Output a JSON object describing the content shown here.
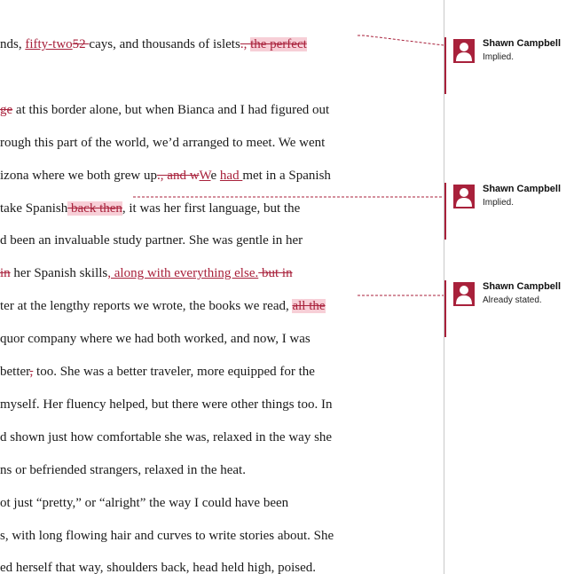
{
  "document": {
    "lines": [
      [
        {
          "t": "nds, ",
          "s": ""
        },
        {
          "t": "fifty-two",
          "s": "ins"
        },
        {
          "t": "52 ",
          "s": "del"
        },
        {
          "t": "cays, and thousands of islets",
          "s": ""
        },
        {
          "t": "., ",
          "s": "del"
        },
        {
          "t": "the perfect",
          "s": "del hl"
        },
        {
          "t": "            ",
          "s": "hl"
        }
      ],
      [],
      [
        {
          "t": "ge",
          "s": "del"
        },
        {
          "t": " at this border alone, but when Bianca and I had figured out",
          "s": ""
        }
      ],
      [
        {
          "t": "rough this part of the world, we’d arranged to meet. We went",
          "s": ""
        }
      ],
      [
        {
          "t": "izona where we both grew up",
          "s": ""
        },
        {
          "t": "., ",
          "s": "del"
        },
        {
          "t": "and w",
          "s": "del"
        },
        {
          "t": "W",
          "s": "ins"
        },
        {
          "t": "e ",
          "s": ""
        },
        {
          "t": "had ",
          "s": "ins"
        },
        {
          "t": "met in a Spanish",
          "s": ""
        }
      ],
      [
        {
          "t": "take Spanish",
          "s": ""
        },
        {
          "t": " back then",
          "s": "del hl"
        },
        {
          "t": ", it was her first language, but the",
          "s": ""
        }
      ],
      [
        {
          "t": "d been an invaluable study partner. She was gentle in her",
          "s": ""
        }
      ],
      [
        {
          "t": " in",
          "s": "del"
        },
        {
          "t": " her Spanish skills",
          "s": ""
        },
        {
          "t": ", along with everything else.",
          "s": "ins"
        },
        {
          "t": " but in",
          "s": "del"
        }
      ],
      [
        {
          "t": "ter at the lengthy reports we wrote, the books we read, ",
          "s": ""
        },
        {
          "t": "all the",
          "s": "del hl"
        },
        {
          "t": "      ",
          "s": "hl"
        }
      ],
      [
        {
          "t": "quor company where we had both worked, and now, I was",
          "s": ""
        }
      ],
      [
        {
          "t": "better",
          "s": ""
        },
        {
          "t": ",",
          "s": "del"
        },
        {
          "t": " too. She was a better traveler, more equipped for the",
          "s": ""
        }
      ],
      [
        {
          "t": " myself. Her fluency helped, but there were other things too. In",
          "s": ""
        }
      ],
      [
        {
          "t": "d shown just how comfortable she was, relaxed in the way she",
          "s": ""
        }
      ],
      [
        {
          "t": "ns or befriended strangers, relaxed in the heat.",
          "s": ""
        }
      ],
      [
        {
          "t": "ot just “pretty,” or “alright” the way I could have been",
          "s": ""
        }
      ],
      [
        {
          "t": "s, with long flowing hair and curves to write stories about. She",
          "s": ""
        }
      ],
      [
        {
          "t": "ed herself that way, shoulders back, head held high, poised.",
          "s": ""
        }
      ]
    ]
  },
  "comments": [
    {
      "author": "Shawn Campbell",
      "text": "Implied.",
      "icon": "user-avatar-icon"
    },
    {
      "author": "Shawn Campbell",
      "text": "Implied.",
      "icon": "user-avatar-icon"
    },
    {
      "author": "Shawn Campbell",
      "text": "Already stated.",
      "icon": "user-avatar-icon"
    }
  ],
  "colors": {
    "revision": "#a8213b",
    "highlight": "#f7cfd7",
    "divider": "#c8c8c8"
  }
}
